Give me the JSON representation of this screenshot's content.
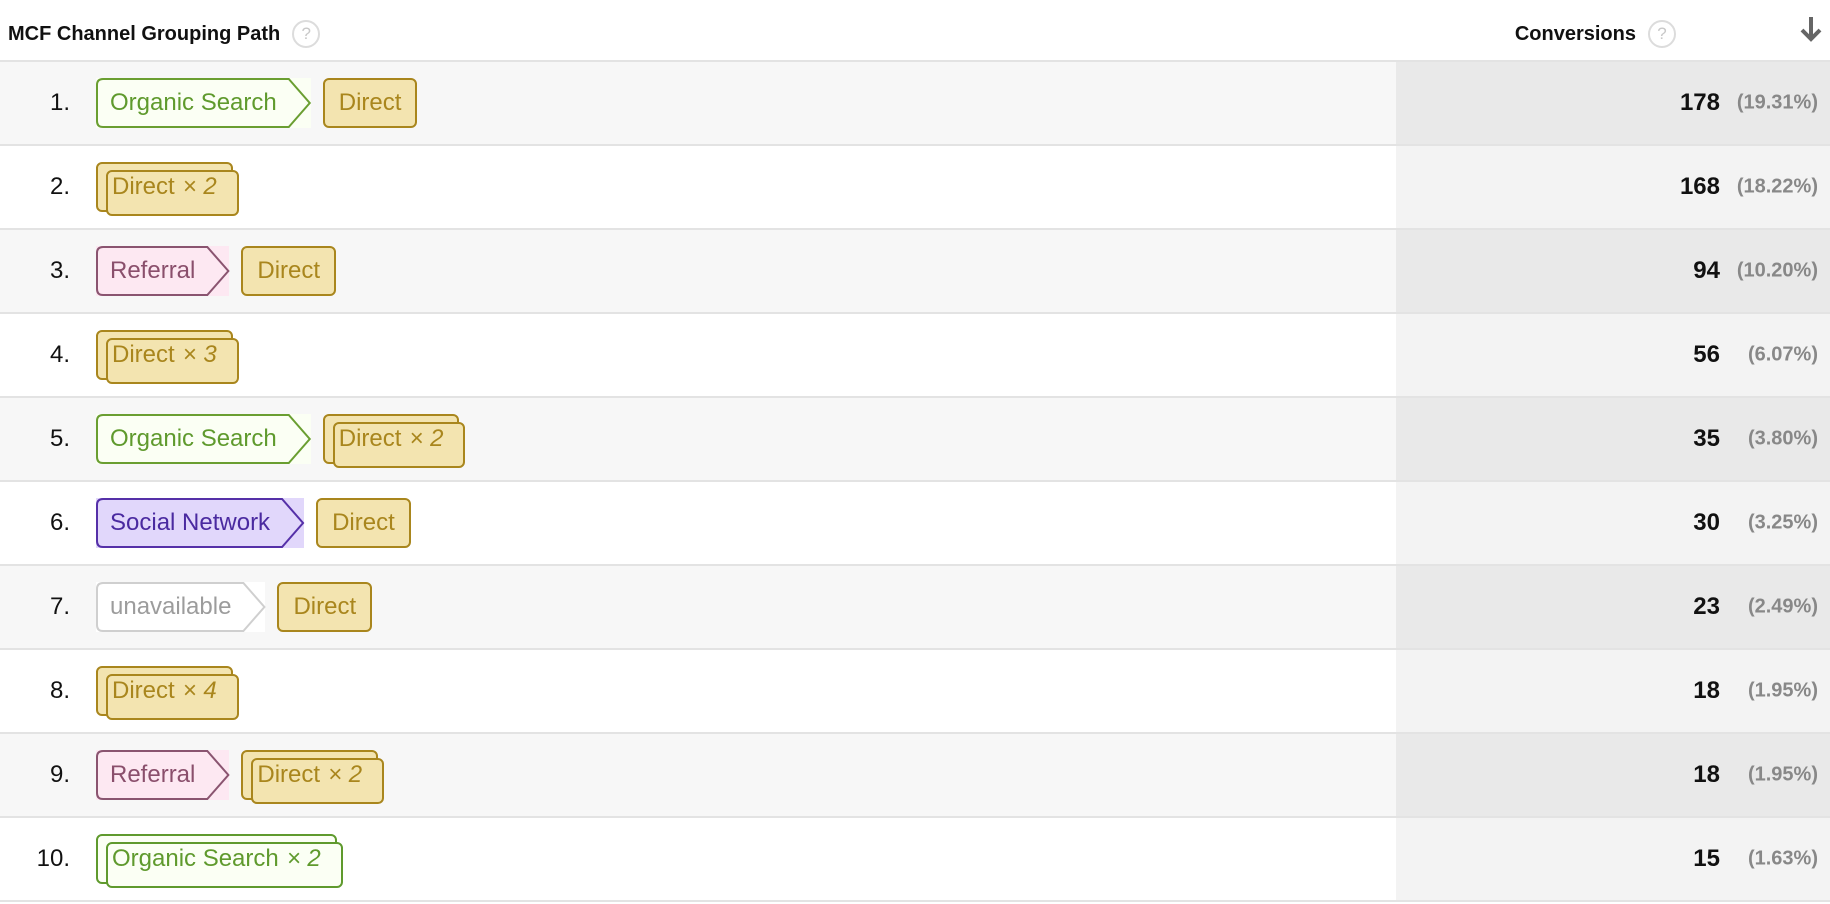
{
  "header": {
    "path_label": "MCF Channel Grouping Path",
    "conversions_label": "Conversions",
    "help_glyph": "?",
    "sort_icon": "arrow-down-icon",
    "sort_direction": "descending"
  },
  "colors": {
    "direct": "#f3e4b0",
    "organic_search": "#fbfff4",
    "referral": "#fde8f2",
    "social_network": "#e1d7fb",
    "unavailable": "#ffffff"
  },
  "rows": [
    {
      "rank": "1.",
      "path": [
        {
          "channel": "Organic Search",
          "type": "organic",
          "mult": ""
        },
        {
          "channel": "Direct",
          "type": "direct",
          "mult": ""
        }
      ],
      "value": "178",
      "pct": "(19.31%)"
    },
    {
      "rank": "2.",
      "path": [
        {
          "channel": "Direct",
          "type": "direct",
          "mult": "× 2"
        }
      ],
      "value": "168",
      "pct": "(18.22%)"
    },
    {
      "rank": "3.",
      "path": [
        {
          "channel": "Referral",
          "type": "referral",
          "mult": ""
        },
        {
          "channel": "Direct",
          "type": "direct",
          "mult": ""
        }
      ],
      "value": "94",
      "pct": "(10.20%)"
    },
    {
      "rank": "4.",
      "path": [
        {
          "channel": "Direct",
          "type": "direct",
          "mult": "× 3"
        }
      ],
      "value": "56",
      "pct": "(6.07%)"
    },
    {
      "rank": "5.",
      "path": [
        {
          "channel": "Organic Search",
          "type": "organic",
          "mult": ""
        },
        {
          "channel": "Direct",
          "type": "direct",
          "mult": "× 2"
        }
      ],
      "value": "35",
      "pct": "(3.80%)"
    },
    {
      "rank": "6.",
      "path": [
        {
          "channel": "Social Network",
          "type": "social",
          "mult": ""
        },
        {
          "channel": "Direct",
          "type": "direct",
          "mult": ""
        }
      ],
      "value": "30",
      "pct": "(3.25%)"
    },
    {
      "rank": "7.",
      "path": [
        {
          "channel": "unavailable",
          "type": "unavail",
          "mult": ""
        },
        {
          "channel": "Direct",
          "type": "direct",
          "mult": ""
        }
      ],
      "value": "23",
      "pct": "(2.49%)"
    },
    {
      "rank": "8.",
      "path": [
        {
          "channel": "Direct",
          "type": "direct",
          "mult": "× 4"
        }
      ],
      "value": "18",
      "pct": "(1.95%)"
    },
    {
      "rank": "9.",
      "path": [
        {
          "channel": "Referral",
          "type": "referral",
          "mult": ""
        },
        {
          "channel": "Direct",
          "type": "direct",
          "mult": "× 2"
        }
      ],
      "value": "18",
      "pct": "(1.95%)"
    },
    {
      "rank": "10.",
      "path": [
        {
          "channel": "Organic Search",
          "type": "organic",
          "mult": "× 2"
        }
      ],
      "value": "15",
      "pct": "(1.63%)"
    }
  ]
}
